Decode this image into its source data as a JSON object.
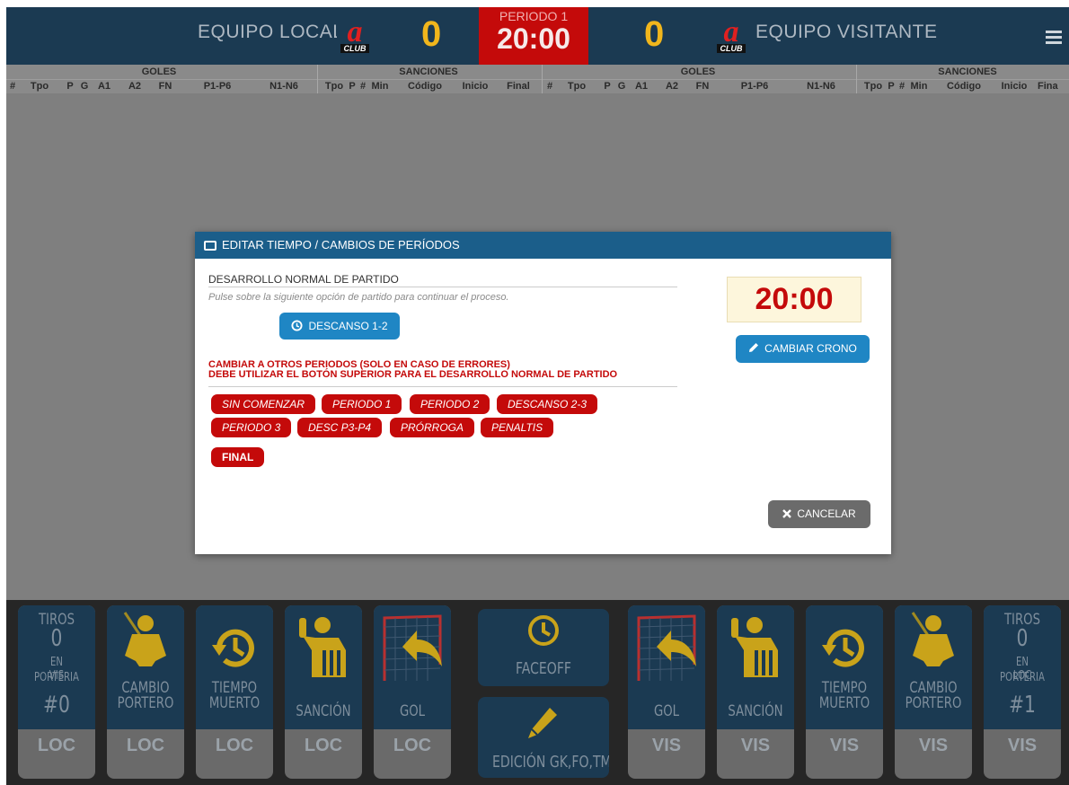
{
  "scoreboard": {
    "home_team": "EQUIPO LOCAL",
    "away_team": "EQUIPO VISITANTE",
    "home_goals": "0",
    "away_goals": "0",
    "period": "PERIODO 1",
    "clock": "20:00",
    "logo_text": "CLUB"
  },
  "table_header": {
    "groups": [
      "GOLES",
      "SANCIONES",
      "GOLES",
      "SANCIONES"
    ],
    "goal_columns": [
      "#",
      "Tpo",
      "P",
      "G",
      "A1",
      "A2",
      "FN",
      "P1-P6",
      "N1-N6"
    ],
    "sanction_columns": [
      "Tpo",
      "P",
      "#",
      "Min",
      "Código",
      "Inicio",
      "Final"
    ],
    "sanction_columns_right": [
      "Tpo",
      "P",
      "#",
      "Min",
      "Código",
      "Inicio",
      "Fina"
    ]
  },
  "modal": {
    "title": "EDITAR TIEMPO / CAMBIOS DE PERÍODOS",
    "normal_section": "DESARROLLO NORMAL DE PARTIDO",
    "hint": "Pulse sobre la siguiente opción de partido para continuar el proceso.",
    "next_button": "DESCANSO 1-2",
    "warning_line1": "CAMBIAR A OTROS PERIODOS (SOLO EN CASO DE ERRORES)",
    "warning_line2": "DEBE UTILIZAR EL BOTÓN SUPERIOR PARA EL DESARROLLO NORMAL DE PARTIDO",
    "periods": [
      "SIN COMENZAR",
      "PERIODO 1",
      "PERIODO 2",
      "DESCANSO 2-3",
      "PERIODO 3",
      "DESC P3-P4",
      "PRÓRROGA",
      "PENALTIS",
      "FINAL"
    ],
    "clock": "20:00",
    "change_clock_button": "CAMBIAR CRONO",
    "cancel_button": "CANCELAR"
  },
  "bottom": {
    "shots_label": "TIROS",
    "shots_home": "0",
    "shots_away": "0",
    "on_goal_label": "EN PORTERIA",
    "vis_label": "VIS",
    "loc_label": "LOC",
    "home_goalie": "#0",
    "away_goalie": "#1",
    "goalie_change": "CAMBIO PORTERO",
    "timeout": "TIEMPO MUERTO",
    "penalty": "SANCIÓN",
    "goal": "GOL",
    "faceoff": "FACEOFF",
    "edit": "EDICIÓN GK,FO,TM",
    "loc": "LOC",
    "vis": "VIS"
  },
  "colors": {
    "navy": "#1b3a52",
    "red": "#c40a0a",
    "blue": "#1f86c4",
    "gold": "#f1b61c"
  }
}
